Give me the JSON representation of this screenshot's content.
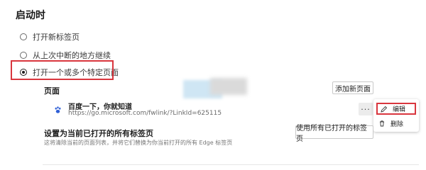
{
  "startup": {
    "title": "启动时",
    "options": [
      {
        "label": "打开新标签页",
        "checked": false
      },
      {
        "label": "从上次中断的地方继续",
        "checked": false
      },
      {
        "label": "打开一个或多个特定页面",
        "checked": true
      }
    ]
  },
  "pages": {
    "label": "页面",
    "add_button": "添加新页面",
    "items": [
      {
        "icon": "baidu-paw-icon",
        "name": "百度一下，你就知道",
        "url": "https://go.microsoft.com/fwlink/?LinkId=625115"
      }
    ],
    "more_label": "···"
  },
  "context_menu": {
    "edit_label": "编辑",
    "delete_label": "删除"
  },
  "set_current": {
    "title": "设置为当前已打开的所有标签页",
    "description": "这将清除当前的页面列表，并将它们替换为你当前打开的所有 Edge 标签页",
    "button": "使用所有已打开的标签页"
  },
  "colors": {
    "highlight": "#d9363e",
    "icon_blue": "#2f5fd6"
  }
}
